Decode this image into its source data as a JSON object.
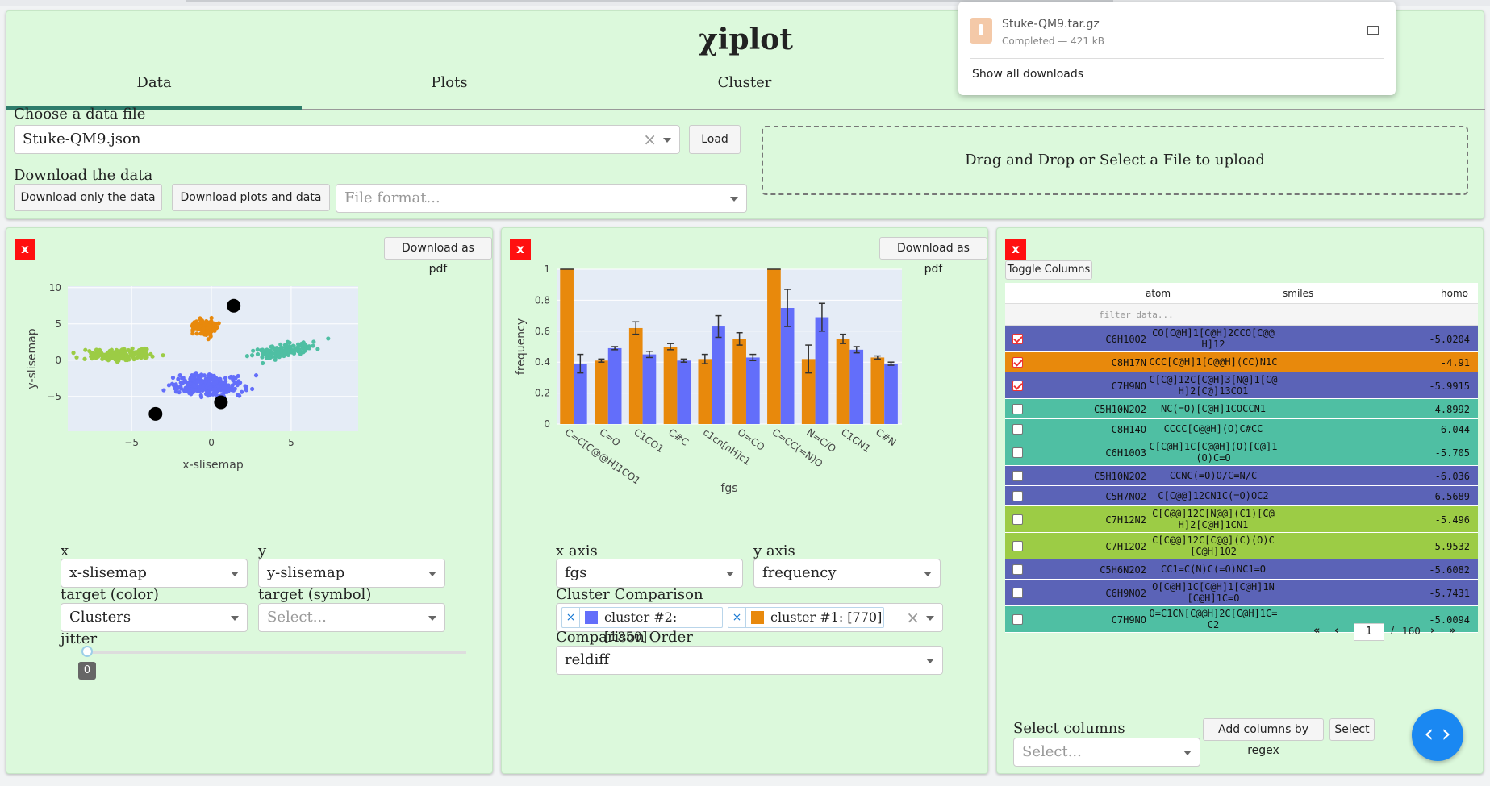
{
  "app": {
    "title": "χiplot"
  },
  "tabs": [
    {
      "label": "Data"
    },
    {
      "label": "Plots"
    },
    {
      "label": "Cluster"
    }
  ],
  "data_tab": {
    "choose_label": "Choose a data file",
    "file_value": "Stuke-QM9.json",
    "load_label": "Load",
    "download_label": "Download the data",
    "dl_only_data": "Download only the data",
    "dl_plots_data": "Download plots and data",
    "file_format_placeholder": "File format...",
    "dropzone_text": "Drag and Drop or Select a File to upload"
  },
  "downloads_popup": {
    "filename": "Stuke-QM9.tar.gz",
    "status": "Completed — 421 kB",
    "show_all": "Show all downloads"
  },
  "scatter_panel": {
    "close": "x",
    "download_pdf": "Download as pdf",
    "x_label": "x",
    "x_value": "x-slisemap",
    "y_label": "y",
    "y_value": "y-slisemap",
    "color_label": "target (color)",
    "color_value": "Clusters",
    "symbol_label": "target (symbol)",
    "symbol_placeholder": "Select...",
    "jitter_label": "jitter",
    "jitter_value": 0
  },
  "bar_panel": {
    "close": "x",
    "download_pdf": "Download as pdf",
    "xaxis_label": "x axis",
    "xaxis_value": "fgs",
    "yaxis_label": "y axis",
    "yaxis_value": "frequency",
    "comparison_label": "Cluster Comparison",
    "comparison_tags": [
      {
        "label": "cluster #2: [1350]",
        "color": "#636efa"
      },
      {
        "label": "cluster #1: [770]",
        "color": "#e8890c"
      }
    ],
    "order_label": "Comparison Order",
    "order_value": "reldiff"
  },
  "table_panel": {
    "close": "x",
    "toggle_columns": "Toggle Columns",
    "headers": [
      "atom",
      "smiles",
      "homo"
    ],
    "filter_placeholder": "filter data...",
    "rows": [
      {
        "atom": "C6H10O2",
        "smiles": "CO[C@H]1[C@H]2CCO[C@@H]12",
        "homo": "-5.0204",
        "color": "#5b63b7",
        "checked": true
      },
      {
        "atom": "C8H17N",
        "smiles": "CCC[C@H]1[C@@H](CC)N1C",
        "homo": "-4.91",
        "color": "#e8890c",
        "checked": true
      },
      {
        "atom": "C7H9NO",
        "smiles": "C[C@]12C[C@H]3[N@]1[C@H]2[C@]13CO1",
        "homo": "-5.9915",
        "color": "#5b63b7",
        "checked": true
      },
      {
        "atom": "C5H10N2O2",
        "smiles": "NC(=O)[C@H]1COCCN1",
        "homo": "-4.8992",
        "color": "#4fbfa3",
        "checked": false
      },
      {
        "atom": "C8H14O",
        "smiles": "CCCC[C@@H](O)C#CC",
        "homo": "-6.044",
        "color": "#4fbfa3",
        "checked": false
      },
      {
        "atom": "C6H10O3",
        "smiles": "C[C@H]1C[C@@H](O)[C@]1(O)C=O",
        "homo": "-5.705",
        "color": "#4fbfa3",
        "checked": false
      },
      {
        "atom": "C5H10N2O2",
        "smiles": "CCNC(=O)O/C=N/C",
        "homo": "-6.036",
        "color": "#5b63b7",
        "checked": false
      },
      {
        "atom": "C5H7NO2",
        "smiles": "C[C@@]12CN1C(=O)OC2",
        "homo": "-6.5689",
        "color": "#5b63b7",
        "checked": false
      },
      {
        "atom": "C7H12N2",
        "smiles": "C[C@@]12C[N@@](C1)[C@H]2[C@H]1CN1",
        "homo": "-5.496",
        "color": "#9ccc45",
        "checked": false
      },
      {
        "atom": "C7H12O2",
        "smiles": "C[C@@]12C[C@@](C)(O)C[C@H]1O2",
        "homo": "-5.9532",
        "color": "#9ccc45",
        "checked": false
      },
      {
        "atom": "C5H6N2O2",
        "smiles": "CC1=C(N)C(=O)NC1=O",
        "homo": "-5.6082",
        "color": "#5b63b7",
        "checked": false
      },
      {
        "atom": "C6H9NO2",
        "smiles": "O[C@H]1C[C@H]1[C@H]1N[C@H]1C=O",
        "homo": "-5.7431",
        "color": "#5b63b7",
        "checked": false
      },
      {
        "atom": "C7H9NO",
        "smiles": "O=C1CN[C@@H]2C[C@H]1C=C2",
        "homo": "-5.0094",
        "color": "#4fbfa3",
        "checked": false
      }
    ],
    "pager": {
      "page": "1",
      "total": "160"
    },
    "select_columns_label": "Select columns",
    "select_placeholder": "Select...",
    "add_regex": "Add columns by regex",
    "select_btn": "Select"
  },
  "chart_data": [
    {
      "type": "scatter",
      "xlabel": "x-slisemap",
      "ylabel": "y-slisemap",
      "xlim": [
        -9,
        9.2
      ],
      "ylim": [
        -9.8,
        10.2
      ],
      "xticks": [
        -5,
        0,
        5
      ],
      "yticks": [
        -5,
        0,
        5,
        10
      ],
      "clusters": [
        {
          "color": "#9ccc45",
          "cx": -5.6,
          "cy": 0.8,
          "sx": 1.5,
          "sy": 0.5,
          "n": 170
        },
        {
          "color": "#e8890c",
          "cx": -0.4,
          "cy": 4.5,
          "sx": 0.6,
          "sy": 0.8,
          "n": 110
        },
        {
          "color": "#4fbfa3",
          "cx": 4.5,
          "cy": 1.3,
          "sx": 1.3,
          "sy": 0.65,
          "n": 130
        },
        {
          "color": "#636efa",
          "cx": -0.2,
          "cy": -3.4,
          "sx": 1.5,
          "sy": 1.0,
          "n": 300
        }
      ],
      "highlights": [
        {
          "x": 1.4,
          "y": 7.5
        },
        {
          "x": 0.6,
          "y": -5.8
        },
        {
          "x": -3.5,
          "y": -7.4
        }
      ]
    },
    {
      "type": "bar",
      "xlabel": "fgs",
      "ylabel": "frequency",
      "ylim": [
        0,
        1
      ],
      "yticks": [
        0,
        0.2,
        0.4,
        0.6,
        0.8,
        1
      ],
      "categories": [
        "C=C[C@@H]1CO1",
        "C=O",
        "C1CO1",
        "C#C",
        "c1cn[nH]c1",
        "O=CO",
        "C=CC(=N)O",
        "N=C/O",
        "C1CN1",
        "C#N"
      ],
      "series": [
        {
          "name": "cluster #1: [770]",
          "color": "#e8890c",
          "values": [
            1.0,
            0.41,
            0.62,
            0.5,
            0.42,
            0.55,
            1.0,
            0.42,
            0.55,
            0.43
          ],
          "err": [
            0,
            0.01,
            0.04,
            0.02,
            0.03,
            0.04,
            0,
            0.09,
            0.03,
            0.01
          ]
        },
        {
          "name": "cluster #2: [1350]",
          "color": "#636efa",
          "values": [
            0.39,
            0.49,
            0.45,
            0.41,
            0.63,
            0.43,
            0.75,
            0.69,
            0.48,
            0.39
          ],
          "err": [
            0.06,
            0.01,
            0.02,
            0.01,
            0.07,
            0.02,
            0.12,
            0.09,
            0.02,
            0.01
          ]
        }
      ]
    }
  ]
}
